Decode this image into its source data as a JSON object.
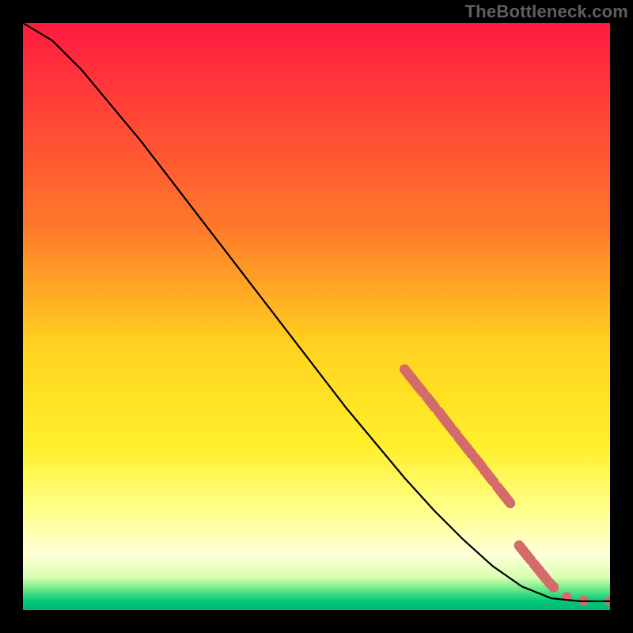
{
  "watermark": "TheBottleneck.com",
  "colors": {
    "background": "#000000",
    "gradient_stops": [
      {
        "offset": 0.0,
        "color": "#ff1a40"
      },
      {
        "offset": 0.35,
        "color": "#ff7a2a"
      },
      {
        "offset": 0.55,
        "color": "#ffd21f"
      },
      {
        "offset": 0.72,
        "color": "#fff02a"
      },
      {
        "offset": 0.83,
        "color": "#ffff8a"
      },
      {
        "offset": 0.905,
        "color": "#ffffd8"
      },
      {
        "offset": 0.945,
        "color": "#d8ffb0"
      },
      {
        "offset": 0.965,
        "color": "#66e887"
      },
      {
        "offset": 0.985,
        "color": "#00c97a"
      },
      {
        "offset": 1.0,
        "color": "#00b876"
      }
    ],
    "curve": "#000000",
    "marker": "#d46a6a"
  },
  "chart_data": {
    "type": "line",
    "title": "",
    "xlabel": "",
    "ylabel": "",
    "xlim": [
      0,
      100
    ],
    "ylim": [
      0,
      100
    ],
    "curve": [
      {
        "x": 0,
        "y": 100
      },
      {
        "x": 5,
        "y": 97
      },
      {
        "x": 10,
        "y": 92
      },
      {
        "x": 15,
        "y": 86
      },
      {
        "x": 20,
        "y": 80
      },
      {
        "x": 25,
        "y": 73.5
      },
      {
        "x": 30,
        "y": 67
      },
      {
        "x": 35,
        "y": 60.5
      },
      {
        "x": 40,
        "y": 54
      },
      {
        "x": 45,
        "y": 47.5
      },
      {
        "x": 50,
        "y": 41
      },
      {
        "x": 55,
        "y": 34.5
      },
      {
        "x": 60,
        "y": 28.5
      },
      {
        "x": 65,
        "y": 22.5
      },
      {
        "x": 70,
        "y": 17
      },
      {
        "x": 75,
        "y": 12
      },
      {
        "x": 80,
        "y": 7.5
      },
      {
        "x": 85,
        "y": 4
      },
      {
        "x": 90,
        "y": 2
      },
      {
        "x": 95,
        "y": 1.5
      },
      {
        "x": 100,
        "y": 1.5
      }
    ],
    "marker_segments": [
      {
        "x1": 65.0,
        "y1": 41.0,
        "x2": 68.2,
        "y2": 37.0
      },
      {
        "x1": 68.8,
        "y1": 36.3,
        "x2": 70.2,
        "y2": 34.5
      },
      {
        "x1": 70.8,
        "y1": 33.8,
        "x2": 72.8,
        "y2": 31.2
      },
      {
        "x1": 73.2,
        "y1": 30.7,
        "x2": 73.8,
        "y2": 30.0
      },
      {
        "x1": 74.2,
        "y1": 29.4,
        "x2": 76.5,
        "y2": 26.5
      },
      {
        "x1": 77.0,
        "y1": 25.9,
        "x2": 78.2,
        "y2": 24.4
      },
      {
        "x1": 78.6,
        "y1": 23.8,
        "x2": 80.2,
        "y2": 21.8
      },
      {
        "x1": 80.8,
        "y1": 21.0,
        "x2": 83.0,
        "y2": 18.2
      },
      {
        "x1": 84.5,
        "y1": 11.0,
        "x2": 86.5,
        "y2": 8.5
      },
      {
        "x1": 87.0,
        "y1": 7.9,
        "x2": 89.2,
        "y2": 5.2
      },
      {
        "x1": 89.6,
        "y1": 4.7,
        "x2": 90.4,
        "y2": 3.9
      }
    ],
    "marker_points": [
      {
        "x": 92.6,
        "y": 2.2
      },
      {
        "x": 95.5,
        "y": 1.6
      },
      {
        "x": 100.0,
        "y": 1.5
      }
    ]
  }
}
